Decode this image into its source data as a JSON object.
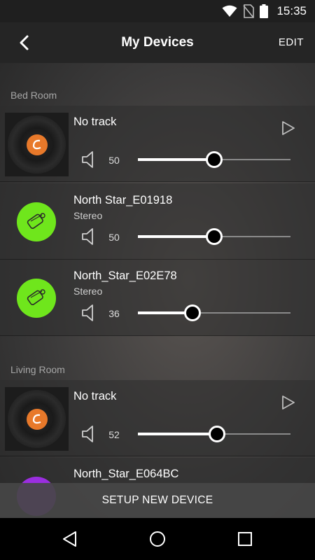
{
  "status_bar": {
    "time": "15:35"
  },
  "header": {
    "title": "My Devices",
    "edit_label": "EDIT"
  },
  "sections": [
    {
      "label": "Bed Room",
      "devices": [
        {
          "name": "No track",
          "subtitle": "",
          "volume": 50,
          "has_play": true,
          "art": "album-art"
        },
        {
          "name": "North Star_E01918",
          "subtitle": "Stereo",
          "volume": 50,
          "has_play": false,
          "art": "speaker-icon"
        },
        {
          "name": "North_Star_E02E78",
          "subtitle": "Stereo",
          "volume": 36,
          "has_play": false,
          "art": "speaker-icon"
        }
      ]
    },
    {
      "label": "Living Room",
      "devices": [
        {
          "name": "No track",
          "subtitle": "",
          "volume": 52,
          "has_play": true,
          "art": "album-art"
        },
        {
          "name": "North_Star_E064BC",
          "subtitle": "",
          "volume": null,
          "has_play": false,
          "art": "speaker-icon"
        }
      ]
    }
  ],
  "footer": {
    "setup_label": "SETUP NEW DEVICE"
  },
  "colors": {
    "speaker_green": "#6fe61c",
    "speaker_purple": "#9b2ee0",
    "logo_orange": "#e8792a"
  }
}
